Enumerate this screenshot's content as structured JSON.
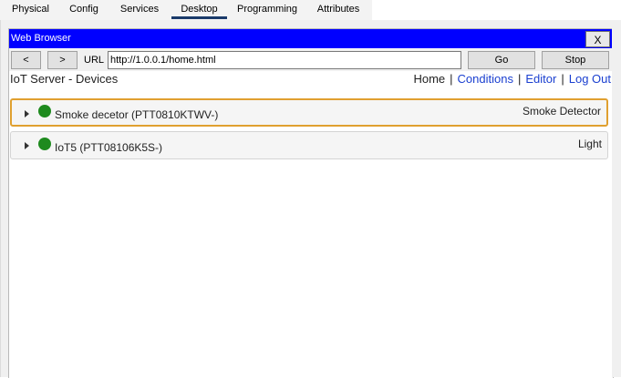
{
  "tabs": [
    {
      "label": "Physical",
      "active": false
    },
    {
      "label": "Config",
      "active": false
    },
    {
      "label": "Services",
      "active": false
    },
    {
      "label": "Desktop",
      "active": true
    },
    {
      "label": "Programming",
      "active": false
    },
    {
      "label": "Attributes",
      "active": false
    }
  ],
  "browser": {
    "title": "Web Browser",
    "close_label": "X",
    "back_label": "<",
    "forward_label": ">",
    "url_label": "URL",
    "url_value": "http://1.0.0.1/home.html",
    "go_label": "Go",
    "stop_label": "Stop",
    "title_bar_color": "#0000ff"
  },
  "page": {
    "title": "IoT Server - Devices",
    "nav": {
      "home": "Home",
      "conditions": "Conditions",
      "editor": "Editor",
      "logout": "Log Out",
      "separator": "|"
    },
    "devices": [
      {
        "name": "Smoke decetor (PTT0810KTWV-)",
        "type": "Smoke Detector",
        "status_color": "#1e8a1e",
        "selected": true
      },
      {
        "name": "IoT5 (PTT08106K5S-)",
        "type": "Light",
        "status_color": "#1e8a1e",
        "selected": false
      }
    ]
  }
}
